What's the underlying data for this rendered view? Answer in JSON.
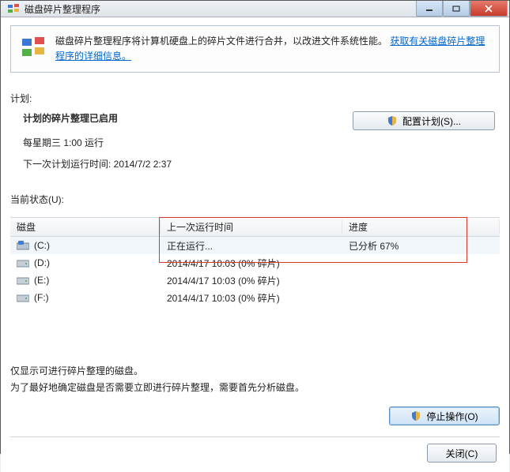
{
  "window": {
    "title": "磁盘碎片整理程序"
  },
  "info": {
    "text_prefix": "磁盘碎片整理程序将计算机硬盘上的碎片文件进行合并，以改进文件系统性能。",
    "link_text": "获取有关磁盘碎片整理程序的详细信息。"
  },
  "schedule": {
    "section_label": "计划:",
    "enabled_title": "计划的碎片整理已启用",
    "run_every": "每星期三  1:00 运行",
    "next_run": "下一次计划运行时间: 2014/7/2 2:37",
    "config_button": "配置计划(S)..."
  },
  "status": {
    "section_label": "当前状态(U):",
    "columns": {
      "disk": "磁盘",
      "last_run": "上一次运行时间",
      "progress": "进度"
    },
    "rows": [
      {
        "disk": "(C:)",
        "icon": "drive-c",
        "last_run": "正在运行...",
        "progress": "已分析 67%",
        "selected": true
      },
      {
        "disk": "(D:)",
        "icon": "drive",
        "last_run": "2014/4/17 10:03 (0% 碎片)",
        "progress": "",
        "selected": false
      },
      {
        "disk": "(E:)",
        "icon": "drive",
        "last_run": "2014/4/17 10:03 (0% 碎片)",
        "progress": "",
        "selected": false
      },
      {
        "disk": "(F:)",
        "icon": "drive",
        "last_run": "2014/4/17 10:03 (0% 碎片)",
        "progress": "",
        "selected": false
      }
    ]
  },
  "footer": {
    "note_line1": "仅显示可进行碎片整理的磁盘。",
    "note_line2": "为了最好地确定磁盘是否需要立即进行碎片整理，需要首先分析磁盘。",
    "stop_button": "停止操作(O)",
    "close_button": "关闭(C)"
  }
}
